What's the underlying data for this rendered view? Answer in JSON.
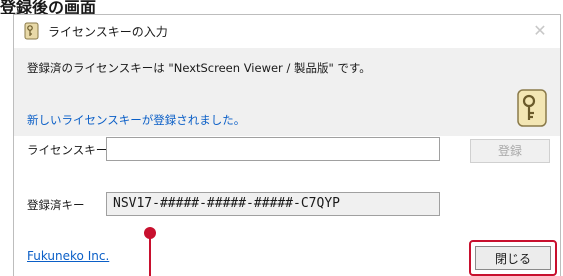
{
  "page_heading": "登録後の画面",
  "dialog": {
    "title": "ライセンスキーの入力",
    "close_glyph": "✕",
    "message": "登録済のライセンスキーは \"NextScreen Viewer / 製品版\" です。",
    "success_message": "新しいライセンスキーが登録されました。",
    "license_key_label": "ライセンスキー",
    "license_key_value": "",
    "register_button": "登録",
    "registered_key_label": "登録済キー",
    "registered_key_value": "NSV17-#####-#####-#####-C7QYP",
    "company_link": "Fukuneko Inc.",
    "close_button": "閉じる"
  },
  "colors": {
    "highlight": "#c8102e",
    "link": "#0b5fc7",
    "panel": "#f0f0f0"
  },
  "icons": {
    "title_icon": "key-icon",
    "large_icon": "key-icon"
  }
}
